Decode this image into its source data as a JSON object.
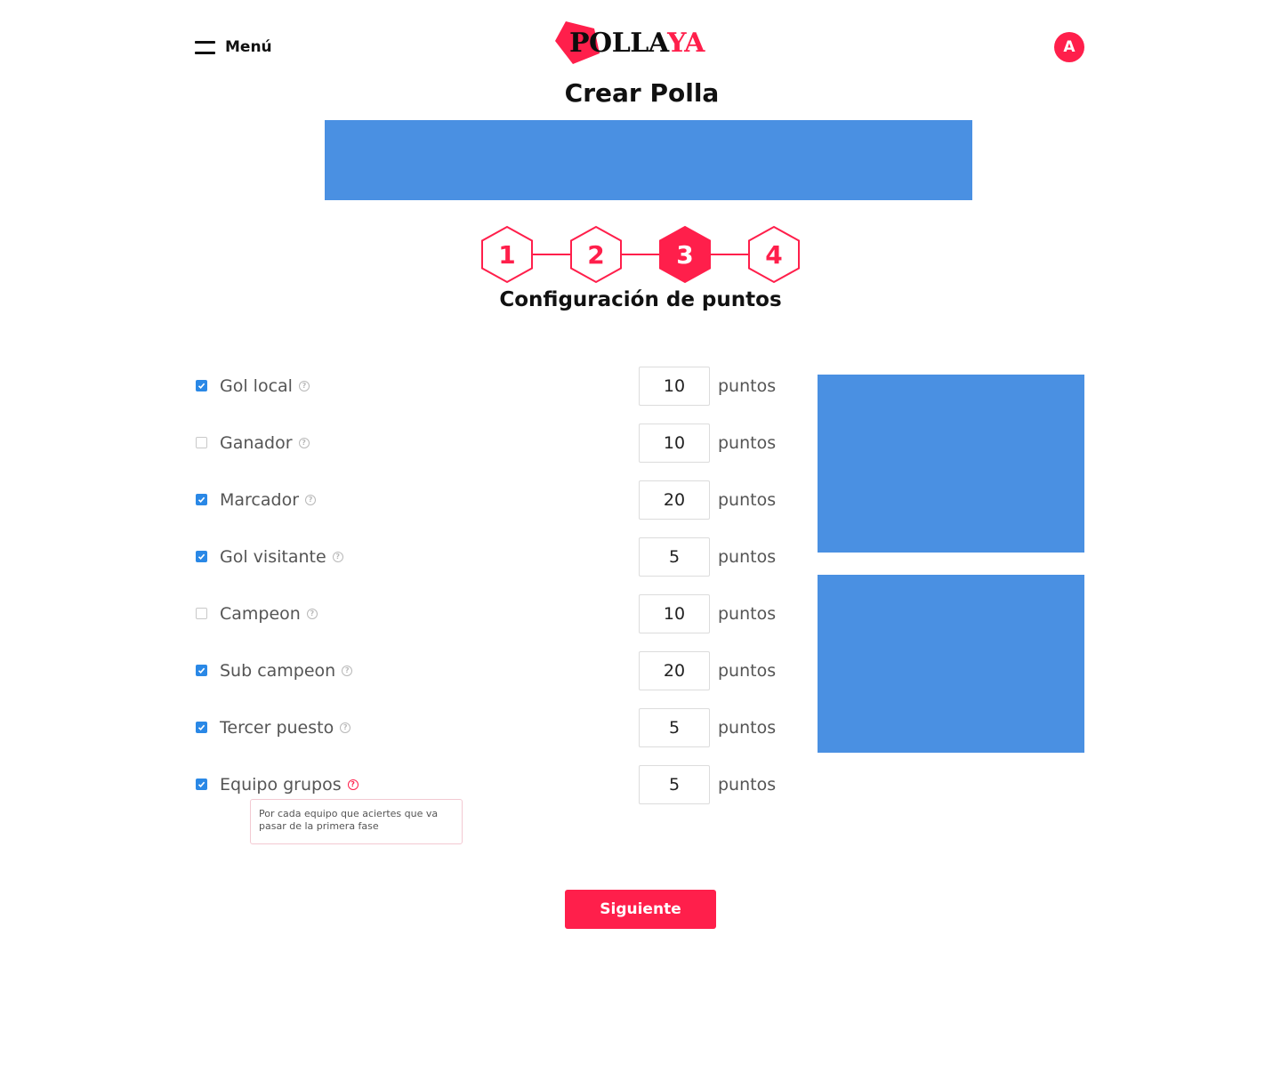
{
  "header": {
    "menu_label": "Menú",
    "logo": {
      "part1": "POLLA",
      "part2": "YA"
    },
    "avatar_initial": "A"
  },
  "page_title": "Crear Polla",
  "stepper": {
    "steps": [
      "1",
      "2",
      "3",
      "4"
    ],
    "active_step": 3
  },
  "section_title": "Configuración de puntos",
  "points": {
    "unit_label": "puntos",
    "rows": [
      {
        "label": "Gol local",
        "checked": true,
        "value": "10"
      },
      {
        "label": "Ganador",
        "checked": false,
        "value": "10"
      },
      {
        "label": "Marcador",
        "checked": true,
        "value": "20"
      },
      {
        "label": "Gol visitante",
        "checked": true,
        "value": "5"
      },
      {
        "label": "Campeon",
        "checked": false,
        "value": "10"
      },
      {
        "label": "Sub campeon",
        "checked": true,
        "value": "20"
      },
      {
        "label": "Tercer puesto",
        "checked": true,
        "value": "5"
      },
      {
        "label": "Equipo grupos",
        "checked": true,
        "value": "5"
      }
    ],
    "help_icon": "question-circle-icon"
  },
  "tooltip": {
    "text": "Por cada equipo que aciertes que va pasar de la primera fase"
  },
  "next_button_label": "Siguiente",
  "colors": {
    "brand": "#ff1f4b",
    "ad_placeholder": "#4a90e2",
    "checkbox": "#2a88e6"
  }
}
